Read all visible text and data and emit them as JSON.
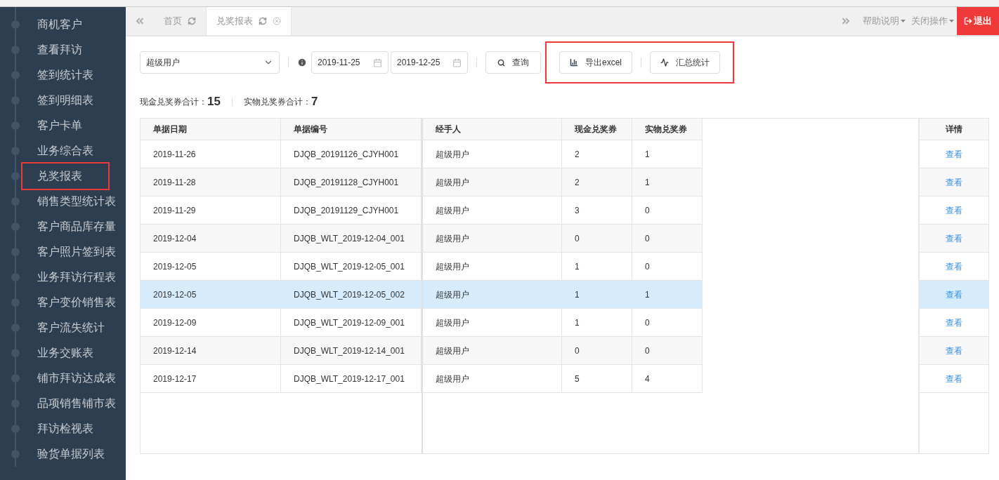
{
  "sidebar": {
    "items": [
      {
        "label": "商机客户",
        "highlighted": false
      },
      {
        "label": "查看拜访",
        "highlighted": false
      },
      {
        "label": "签到统计表",
        "highlighted": false
      },
      {
        "label": "签到明细表",
        "highlighted": false
      },
      {
        "label": "客户卡单",
        "highlighted": false
      },
      {
        "label": "业务综合表",
        "highlighted": false
      },
      {
        "label": "兑奖报表",
        "highlighted": true
      },
      {
        "label": "销售类型统计表",
        "highlighted": false
      },
      {
        "label": "客户商品库存量",
        "highlighted": false
      },
      {
        "label": "客户照片签到表",
        "highlighted": false
      },
      {
        "label": "业务拜访行程表",
        "highlighted": false
      },
      {
        "label": "客户变价销售表",
        "highlighted": false
      },
      {
        "label": "客户流失统计",
        "highlighted": false
      },
      {
        "label": "业务交账表",
        "highlighted": false
      },
      {
        "label": "铺市拜访达成表",
        "highlighted": false
      },
      {
        "label": "品项销售铺市表",
        "highlighted": false
      },
      {
        "label": "拜访检视表",
        "highlighted": false
      },
      {
        "label": "验货单据列表",
        "highlighted": false
      }
    ]
  },
  "tabs": [
    {
      "label": "首页",
      "selected": false,
      "closable": false
    },
    {
      "label": "兑奖报表",
      "selected": true,
      "closable": true
    }
  ],
  "top_right": {
    "help": "帮助说明",
    "close_ops": "关闭操作",
    "logout": "退出"
  },
  "filters": {
    "user": "超级用户",
    "date_from": "2019-11-25",
    "date_to": "2019-12-25",
    "query": "查询",
    "export": "导出excel",
    "summary": "汇总统计",
    "export_highlighted": true
  },
  "totals": [
    {
      "label": "现金兑奖券合计：",
      "value": "15"
    },
    {
      "label": "实物兑奖券合计：",
      "value": "7"
    }
  ],
  "table": {
    "columns": [
      "单据日期",
      "单据编号",
      "经手人",
      "现金兑奖券",
      "实物兑奖券"
    ],
    "detail_column": "详情",
    "rows": [
      {
        "cells": [
          "2019-11-26",
          "DJQB_20191126_CJYH001",
          "超级用户",
          "2",
          "1"
        ],
        "link": "查看",
        "selected": false
      },
      {
        "cells": [
          "2019-11-28",
          "DJQB_20191128_CJYH001",
          "超级用户",
          "2",
          "1"
        ],
        "link": "查看",
        "selected": false
      },
      {
        "cells": [
          "2019-11-29",
          "DJQB_20191129_CJYH001",
          "超级用户",
          "3",
          "0"
        ],
        "link": "查看",
        "selected": false
      },
      {
        "cells": [
          "2019-12-04",
          "DJQB_WLT_2019-12-04_001",
          "超级用户",
          "0",
          "0"
        ],
        "link": "查看",
        "selected": false
      },
      {
        "cells": [
          "2019-12-05",
          "DJQB_WLT_2019-12-05_001",
          "超级用户",
          "1",
          "0"
        ],
        "link": "查看",
        "selected": false
      },
      {
        "cells": [
          "2019-12-05",
          "DJQB_WLT_2019-12-05_002",
          "超级用户",
          "1",
          "1"
        ],
        "link": "查看",
        "selected": true
      },
      {
        "cells": [
          "2019-12-09",
          "DJQB_WLT_2019-12-09_001",
          "超级用户",
          "1",
          "0"
        ],
        "link": "查看",
        "selected": false
      },
      {
        "cells": [
          "2019-12-14",
          "DJQB_WLT_2019-12-14_001",
          "超级用户",
          "0",
          "0"
        ],
        "link": "查看",
        "selected": false
      },
      {
        "cells": [
          "2019-12-17",
          "DJQB_WLT_2019-12-17_001",
          "超级用户",
          "5",
          "4"
        ],
        "link": "查看",
        "selected": false
      }
    ]
  }
}
